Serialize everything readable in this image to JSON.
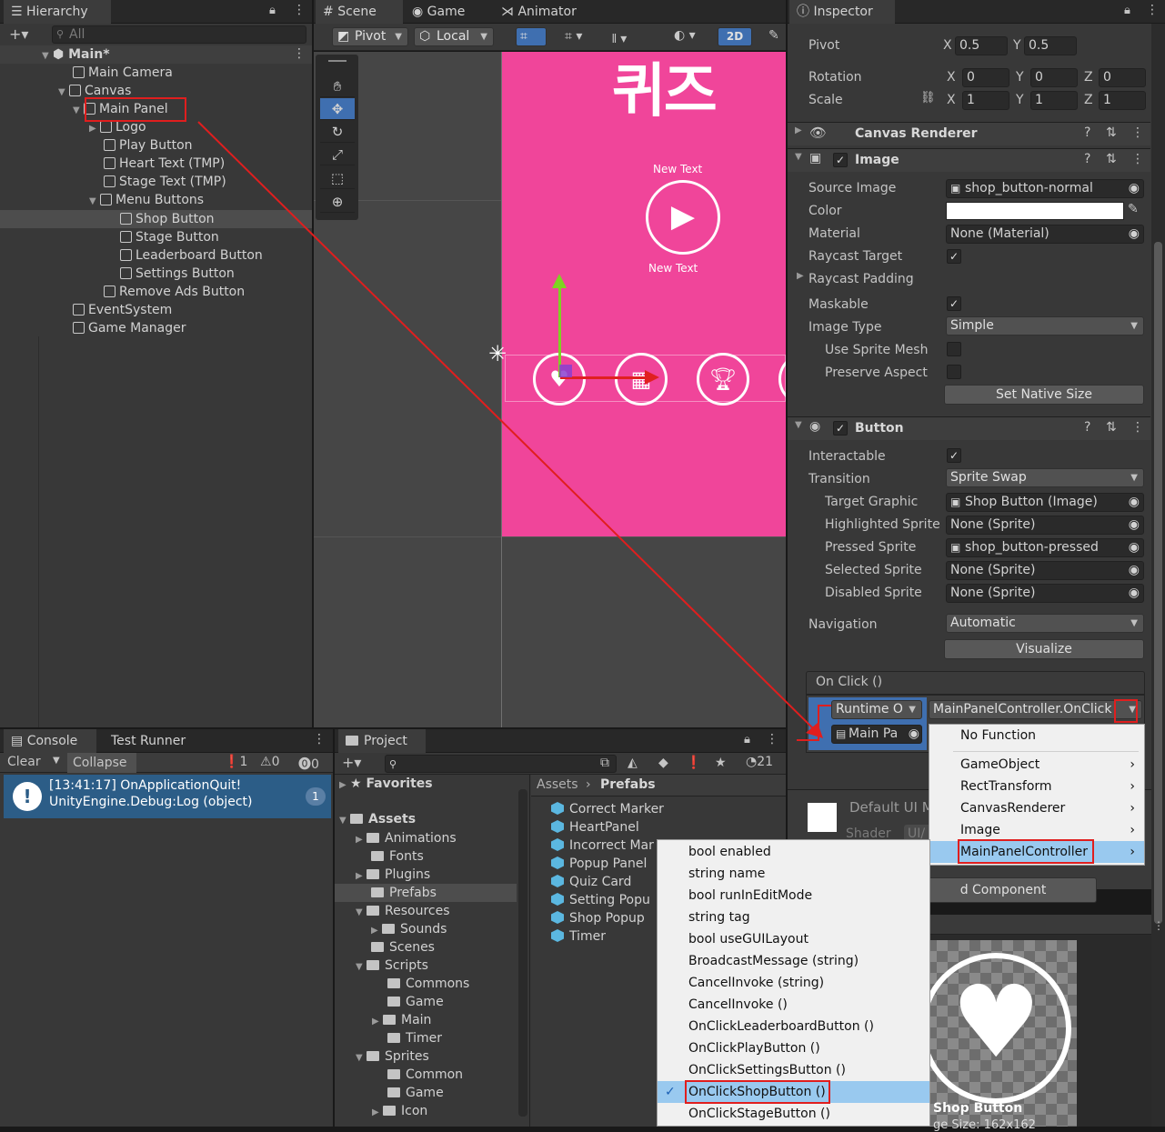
{
  "hierarchy": {
    "tab": "Hierarchy",
    "search_placeholder": "All",
    "scene": "Main*",
    "items": [
      "Main Camera",
      "Canvas",
      "Main Panel",
      "Logo",
      "Play Button",
      "Heart Text (TMP)",
      "Stage Text (TMP)",
      "Menu Buttons",
      "Shop Button",
      "Stage Button",
      "Leaderboard Button",
      "Settings Button",
      "Remove Ads Button",
      "EventSystem",
      "Game Manager"
    ]
  },
  "scene_view": {
    "tabs": [
      "Scene",
      "Game",
      "Animator"
    ],
    "pivot": "Pivot",
    "local": "Local",
    "mode2d": "2D",
    "title_glyphs": "퀴즈",
    "text_top": "New Text",
    "text_bottom": "New Text",
    "colors": {
      "canvas": "#f0459a",
      "accent": "#3f6fb0"
    }
  },
  "inspector": {
    "tab": "Inspector",
    "pivot": {
      "label": "Pivot",
      "x": "0.5",
      "y": "0.5"
    },
    "rotation": {
      "label": "Rotation",
      "x": "0",
      "y": "0",
      "z": "0"
    },
    "scale": {
      "label": "Scale",
      "x": "1",
      "y": "1",
      "z": "1"
    },
    "axes": {
      "x": "X",
      "y": "Y",
      "z": "Z"
    },
    "canvas_renderer": "Canvas Renderer",
    "image": {
      "title": "Image",
      "rows": [
        "Source Image",
        "Color",
        "Material",
        "Raycast Target",
        "Raycast Padding",
        "Maskable",
        "Image Type",
        "Use Sprite Mesh",
        "Preserve Aspect"
      ],
      "source_image": "shop_button-normal",
      "material": "None (Material)",
      "image_type": "Simple",
      "set_native_size": "Set Native Size"
    },
    "button": {
      "title": "Button",
      "rows": [
        "Interactable",
        "Transition",
        "Target Graphic",
        "Highlighted Sprite",
        "Pressed Sprite",
        "Selected Sprite",
        "Disabled Sprite",
        "Navigation"
      ],
      "transition": "Sprite Swap",
      "target_graphic": "Shop Button (Image)",
      "highlighted": "None (Sprite)",
      "pressed": "shop_button-pressed",
      "selected": "None (Sprite)",
      "disabled": "None (Sprite)",
      "navigation": "Automatic",
      "visualize": "Visualize",
      "on_click": "On Click ()",
      "runtime": "Runtime O",
      "function": "MainPanelController.OnClick",
      "object": "Main Pa"
    },
    "default_ui": "Default UI M",
    "shader": "Shader",
    "shader_value": "UI/",
    "add_component": "d Component",
    "preview_label": "Shop Button",
    "preview_size": "ge Size: 162x162"
  },
  "function_menu": {
    "items": [
      "No Function",
      "GameObject",
      "RectTransform",
      "CanvasRenderer",
      "Image",
      "MainPanelController"
    ]
  },
  "method_menu": {
    "items": [
      "bool enabled",
      "string name",
      "bool runInEditMode",
      "string tag",
      "bool useGUILayout",
      "BroadcastMessage (string)",
      "CancelInvoke (string)",
      "CancelInvoke ()",
      "OnClickLeaderboardButton ()",
      "OnClickPlayButton ()",
      "OnClickSettingsButton ()",
      "OnClickShopButton ()",
      "OnClickStageButton ()"
    ],
    "selected": "OnClickShopButton ()"
  },
  "console": {
    "tabs": [
      "Console",
      "Test Runner"
    ],
    "clear": "Clear",
    "collapse": "Collapse",
    "counts": [
      "1",
      "0",
      "0"
    ],
    "message_line1": "[13:41:17] OnApplicationQuit!",
    "message_line2": "UnityEngine.Debug:Log (object)",
    "message_count": "1"
  },
  "project": {
    "tab": "Project",
    "hidden_count": "21",
    "favorites": "Favorites",
    "assets": "Assets",
    "tree": [
      "Animations",
      "Fonts",
      "Plugins",
      "Prefabs",
      "Resources",
      "Sounds",
      "Scenes",
      "Scripts",
      "Commons",
      "Game",
      "Main",
      "Timer",
      "Sprites",
      "Common",
      "Game",
      "Icon"
    ],
    "breadcrumb": [
      "Assets",
      "Prefabs"
    ],
    "prefabs": [
      "Correct Marker",
      "HeartPanel",
      "Incorrect Mar",
      "Popup Panel",
      "Quiz Card",
      "Setting Popu",
      "Shop Popup",
      "Timer"
    ]
  }
}
